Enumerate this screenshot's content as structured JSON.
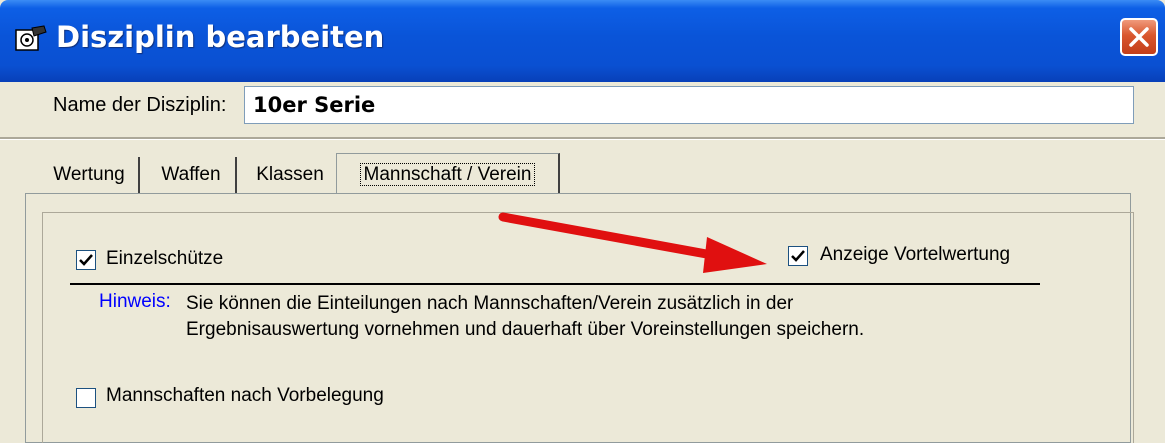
{
  "window": {
    "title": "Disziplin bearbeiten",
    "app_icon": "edit-target-icon",
    "close_icon": "close-icon"
  },
  "name_field": {
    "label": "Name der Disziplin:",
    "value": "10er Serie"
  },
  "tabs": [
    {
      "label": "Wertung",
      "active": false
    },
    {
      "label": "Waffen",
      "active": false
    },
    {
      "label": "Klassen",
      "active": false
    },
    {
      "label": "Mannschaft / Verein",
      "active": true
    }
  ],
  "options": {
    "einzelschuetze": {
      "label": "Einzelschütze",
      "checked": true
    },
    "vortelwertung": {
      "label": "Anzeige Vortelwertung",
      "checked": true
    },
    "vorbelegung": {
      "label": "Mannschaften nach Vorbelegung",
      "checked": false
    }
  },
  "hint": {
    "label": "Hinweis:",
    "line1": "Sie können die Einteilungen nach Mannschaften/Verein zusätzlich in der",
    "line2": "Ergebnisauswertung vornehmen und dauerhaft über Voreinstellungen speichern."
  },
  "colors": {
    "titlebar": "#0a54d8",
    "hint_label": "#0000ff",
    "annotation_arrow": "#e01010"
  }
}
